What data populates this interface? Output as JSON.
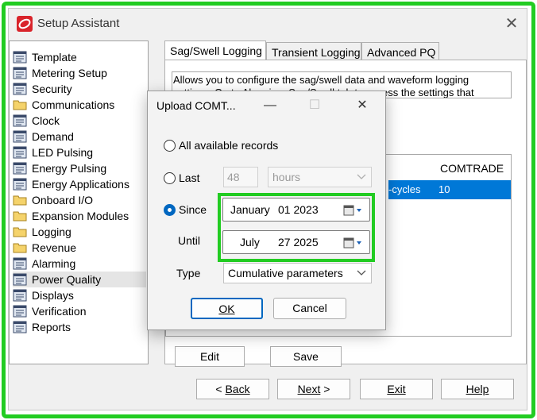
{
  "window": {
    "title": "Setup Assistant",
    "close_glyph": "✕"
  },
  "sidebar": {
    "items": [
      {
        "label": "Template",
        "icon": "page-icon"
      },
      {
        "label": "Metering Setup",
        "icon": "page-icon"
      },
      {
        "label": "Security",
        "icon": "page-icon"
      },
      {
        "label": "Communications",
        "icon": "folder-icon"
      },
      {
        "label": "Clock",
        "icon": "page-icon"
      },
      {
        "label": "Demand",
        "icon": "page-icon"
      },
      {
        "label": "LED Pulsing",
        "icon": "page-icon"
      },
      {
        "label": "Energy Pulsing",
        "icon": "page-icon"
      },
      {
        "label": "Energy Applications",
        "icon": "page-icon"
      },
      {
        "label": "Onboard I/O",
        "icon": "folder-icon"
      },
      {
        "label": "Expansion Modules",
        "icon": "folder-icon"
      },
      {
        "label": "Logging",
        "icon": "folder-icon"
      },
      {
        "label": "Revenue",
        "icon": "folder-icon"
      },
      {
        "label": "Alarming",
        "icon": "page-icon"
      },
      {
        "label": "Power Quality",
        "icon": "page-icon",
        "selected": true
      },
      {
        "label": "Displays",
        "icon": "page-icon"
      },
      {
        "label": "Verification",
        "icon": "page-icon"
      },
      {
        "label": "Reports",
        "icon": "page-icon"
      }
    ]
  },
  "tabs": [
    "Sag/Swell Logging",
    "Transient Logging",
    "Advanced PQ"
  ],
  "panel": {
    "description_line1": "Allows you to configure the sag/swell data and waveform logging",
    "description_line2": "settings.  Go to Alarming, Sag/Swell tab to access the settings that",
    "list_header": "COMTRADE",
    "row_cell1": "-cycles",
    "row_cell2": "10",
    "edit_label": "Edit",
    "save_label": "Save"
  },
  "footer": {
    "back_label": "Back",
    "next_label": "Next",
    "exit_label": "Exit",
    "help_label": "Help"
  },
  "dialog": {
    "title": "Upload COMT...",
    "minimize_glyph": "—",
    "maximize_glyph": "☐",
    "close_glyph": "✕",
    "all_records_label": "All available records",
    "last_label": "Last",
    "last_value": "48",
    "last_unit": "hours",
    "since_label": "Since",
    "since_month": "January",
    "since_day_year": "01 2023",
    "until_label": "Until",
    "until_month": "July",
    "until_day_year": "27 2025",
    "type_label": "Type",
    "type_value": "Cumulative parameters",
    "ok_label": "OK",
    "cancel_label": "Cancel",
    "selected_option": "Since"
  },
  "colors": {
    "highlight": "#22cc22",
    "accent": "#0067c0",
    "list_selected": "#0078d7"
  }
}
